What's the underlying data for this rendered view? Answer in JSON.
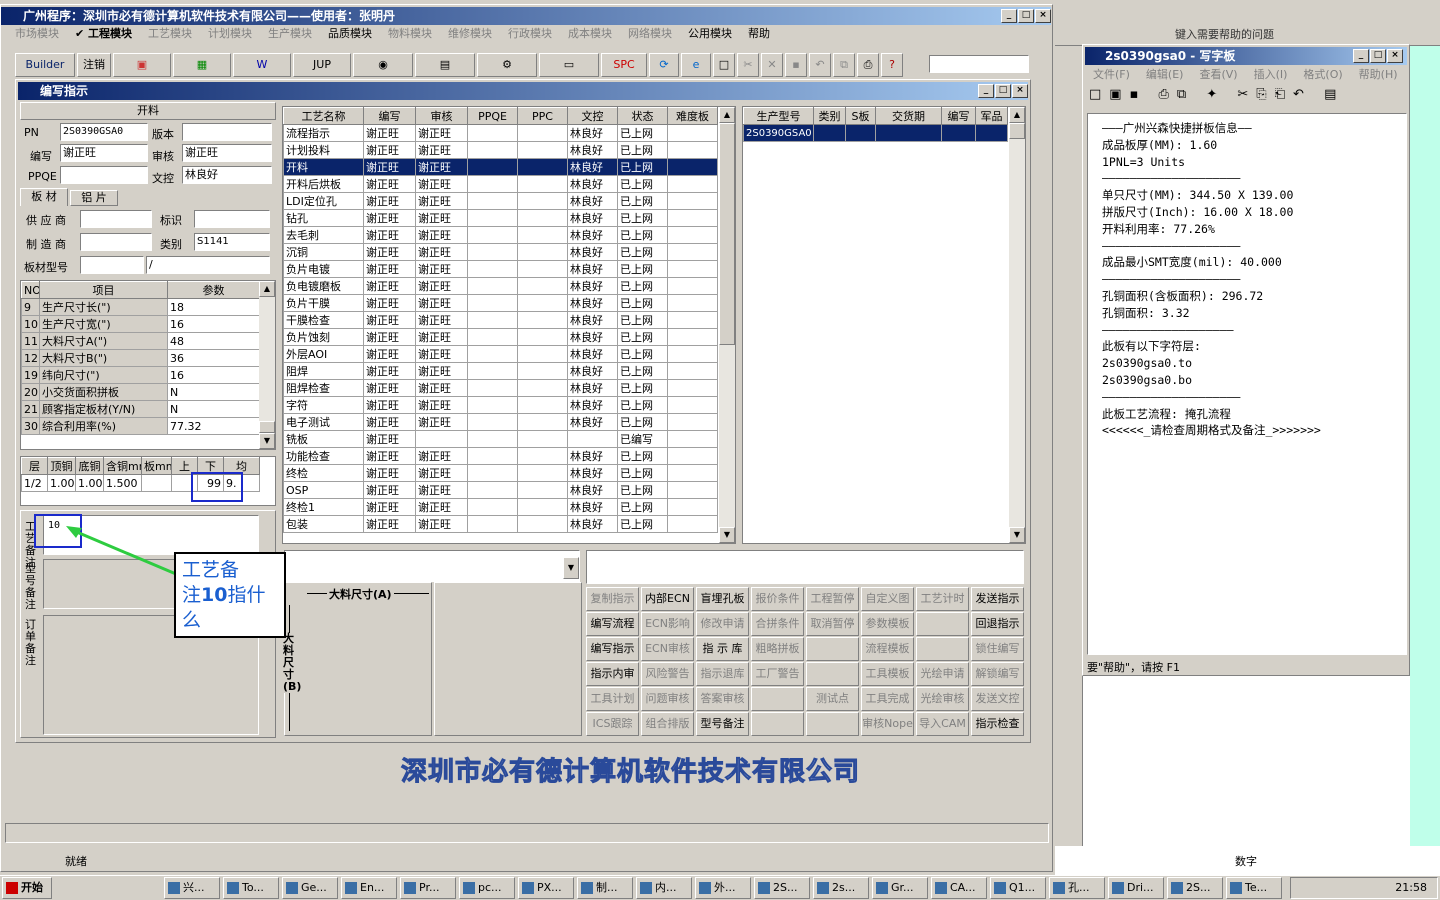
{
  "app": {
    "title": "广州程序：深圳市必有德计算机软件技术有限公司——使用者：张明丹",
    "status": "就绪",
    "footer_logo": "深圳市必有德计算机软件技术有限公司"
  },
  "menu": [
    {
      "label": "市场模块",
      "enabled": false
    },
    {
      "label": "工程模块",
      "enabled": true,
      "checked": true
    },
    {
      "label": "工艺模块",
      "enabled": false
    },
    {
      "label": "计划模块",
      "enabled": false
    },
    {
      "label": "生产模块",
      "enabled": false
    },
    {
      "label": "品质模块",
      "enabled": true
    },
    {
      "label": "物料模块",
      "enabled": false
    },
    {
      "label": "维修模块",
      "enabled": false
    },
    {
      "label": "行政模块",
      "enabled": false
    },
    {
      "label": "成本模块",
      "enabled": false
    },
    {
      "label": "网络模块",
      "enabled": false
    },
    {
      "label": "公用模块",
      "enabled": true
    },
    {
      "label": "帮助",
      "enabled": true
    }
  ],
  "toolbar": {
    "builder": "Builder",
    "logout": "注销",
    "jup": "JUP",
    "spc": "SPC"
  },
  "win": {
    "title": "编写指示"
  },
  "left": {
    "section_title": "开料",
    "pn_label": "PN",
    "pn": "2S0390GSA0",
    "version_label": "版本",
    "version": "",
    "writer_label": "编写",
    "writer": "谢正旺",
    "auditor_label": "审核",
    "auditor": "谢正旺",
    "ppqe_label": "PPQE",
    "ppqe": "",
    "doc_label": "文控",
    "doc": "林良好",
    "tab_board": "板 材",
    "tab_foil": "铝 片",
    "supplier_label": "供 应 商",
    "supplier": "",
    "mark_label": "标识",
    "mark": "",
    "maker_label": "制 造 商",
    "maker": "",
    "category_label": "类别",
    "category": "S1141",
    "model_label": "板材型号",
    "model": "",
    "model2": "/",
    "param_head": [
      "NO",
      "项目",
      "参数"
    ],
    "params": [
      [
        "9",
        "生产尺寸长(\")",
        "18"
      ],
      [
        "10",
        "生产尺寸宽(\")",
        "16"
      ],
      [
        "11",
        "大料尺寸A(\")",
        "48"
      ],
      [
        "12",
        "大料尺寸B(\")",
        "36"
      ],
      [
        "19",
        "纬向尺寸(\")",
        "16"
      ],
      [
        "20",
        "小交货面积拼板",
        "N"
      ],
      [
        "21",
        "顾客指定板材(Y/N)",
        "N"
      ],
      [
        "30",
        "综合利用率(%)",
        "77.32"
      ]
    ],
    "layer_head": [
      "层",
      "顶铜",
      "底铜",
      "含铜mm",
      "板mm",
      "上",
      "下",
      "均"
    ],
    "layer_row": [
      "1/2",
      "1.00",
      "1.00",
      "1.500",
      "",
      "",
      "99",
      "9."
    ],
    "note_value": "10",
    "note_labels": {
      "craft": "工艺备注",
      "model": "型号备注",
      "order": "订单备注"
    }
  },
  "process": {
    "head": [
      "工艺名称",
      "编写",
      "审核",
      "PPQE",
      "PPC",
      "文控",
      "状态",
      "难度板"
    ],
    "rows": [
      [
        "流程指示",
        "谢正旺",
        "谢正旺",
        "",
        "",
        "林良好",
        "已上网",
        ""
      ],
      [
        "计划投料",
        "谢正旺",
        "谢正旺",
        "",
        "",
        "林良好",
        "已上网",
        ""
      ],
      [
        "开料",
        "谢正旺",
        "谢正旺",
        "",
        "",
        "林良好",
        "已上网",
        ""
      ],
      [
        "开料后烘板",
        "谢正旺",
        "谢正旺",
        "",
        "",
        "林良好",
        "已上网",
        ""
      ],
      [
        "LDI定位孔",
        "谢正旺",
        "谢正旺",
        "",
        "",
        "林良好",
        "已上网",
        ""
      ],
      [
        "钻孔",
        "谢正旺",
        "谢正旺",
        "",
        "",
        "林良好",
        "已上网",
        ""
      ],
      [
        "去毛刺",
        "谢正旺",
        "谢正旺",
        "",
        "",
        "林良好",
        "已上网",
        ""
      ],
      [
        "沉铜",
        "谢正旺",
        "谢正旺",
        "",
        "",
        "林良好",
        "已上网",
        ""
      ],
      [
        "负片电镀",
        "谢正旺",
        "谢正旺",
        "",
        "",
        "林良好",
        "已上网",
        ""
      ],
      [
        "负电镀磨板",
        "谢正旺",
        "谢正旺",
        "",
        "",
        "林良好",
        "已上网",
        ""
      ],
      [
        "负片干膜",
        "谢正旺",
        "谢正旺",
        "",
        "",
        "林良好",
        "已上网",
        ""
      ],
      [
        "干膜检查",
        "谢正旺",
        "谢正旺",
        "",
        "",
        "林良好",
        "已上网",
        ""
      ],
      [
        "负片蚀刻",
        "谢正旺",
        "谢正旺",
        "",
        "",
        "林良好",
        "已上网",
        ""
      ],
      [
        "外层AOI",
        "谢正旺",
        "谢正旺",
        "",
        "",
        "林良好",
        "已上网",
        ""
      ],
      [
        "阻焊",
        "谢正旺",
        "谢正旺",
        "",
        "",
        "林良好",
        "已上网",
        ""
      ],
      [
        "阻焊检查",
        "谢正旺",
        "谢正旺",
        "",
        "",
        "林良好",
        "已上网",
        ""
      ],
      [
        "字符",
        "谢正旺",
        "谢正旺",
        "",
        "",
        "林良好",
        "已上网",
        ""
      ],
      [
        "电子测试",
        "谢正旺",
        "谢正旺",
        "",
        "",
        "林良好",
        "已上网",
        ""
      ],
      [
        "铣板",
        "谢正旺",
        "",
        "",
        "",
        "",
        "已编写",
        ""
      ],
      [
        "功能检查",
        "谢正旺",
        "谢正旺",
        "",
        "",
        "林良好",
        "已上网",
        ""
      ],
      [
        "终检",
        "谢正旺",
        "谢正旺",
        "",
        "",
        "林良好",
        "已上网",
        ""
      ],
      [
        "OSP",
        "谢正旺",
        "谢正旺",
        "",
        "",
        "林良好",
        "已上网",
        ""
      ],
      [
        "终检1",
        "谢正旺",
        "谢正旺",
        "",
        "",
        "林良好",
        "已上网",
        ""
      ],
      [
        "包装",
        "谢正旺",
        "谢正旺",
        "",
        "",
        "林良好",
        "已上网",
        ""
      ]
    ],
    "selected": 2
  },
  "prod": {
    "head": [
      "生产型号",
      "类别",
      "S板",
      "交货期",
      "编写",
      "军品"
    ],
    "row": [
      "2S0390GSA0",
      "",
      "",
      "",
      "",
      ""
    ]
  },
  "diagram": {
    "a_label": "大料尺寸(A)",
    "b_label": "大料尺寸(B)"
  },
  "buttons": [
    [
      {
        "t": "复制指示",
        "e": false
      },
      {
        "t": "内部ECN",
        "e": true
      },
      {
        "t": "盲埋孔板",
        "e": true
      },
      {
        "t": "报价条件",
        "e": false
      },
      {
        "t": "工程暂停",
        "e": false
      },
      {
        "t": "自定义图",
        "e": false
      },
      {
        "t": "工艺计时",
        "e": false
      },
      {
        "t": "发送指示",
        "e": true
      }
    ],
    [
      {
        "t": "编写流程",
        "e": true
      },
      {
        "t": "ECN影响",
        "e": false
      },
      {
        "t": "修改申请",
        "e": false
      },
      {
        "t": "合拼条件",
        "e": false
      },
      {
        "t": "取消暂停",
        "e": false
      },
      {
        "t": "参数模板",
        "e": false
      },
      {
        "t": "",
        "e": false
      },
      {
        "t": "回退指示",
        "e": true
      }
    ],
    [
      {
        "t": "编写指示",
        "e": true
      },
      {
        "t": "ECN审核",
        "e": false
      },
      {
        "t": "指 示 库",
        "e": true
      },
      {
        "t": "粗略拼板",
        "e": false
      },
      {
        "t": "",
        "e": false
      },
      {
        "t": "流程模板",
        "e": false
      },
      {
        "t": "",
        "e": false
      },
      {
        "t": "锁住编写",
        "e": false
      }
    ],
    [
      {
        "t": "指示内审",
        "e": true
      },
      {
        "t": "风险警告",
        "e": false
      },
      {
        "t": "指示退库",
        "e": false
      },
      {
        "t": "工厂警告",
        "e": false
      },
      {
        "t": "",
        "e": false
      },
      {
        "t": "工具模板",
        "e": false
      },
      {
        "t": "光绘申请",
        "e": false
      },
      {
        "t": "解锁编写",
        "e": false
      }
    ],
    [
      {
        "t": "工具计划",
        "e": false
      },
      {
        "t": "问题审核",
        "e": false
      },
      {
        "t": "答案审核",
        "e": false
      },
      {
        "t": "",
        "e": false
      },
      {
        "t": "测试点",
        "e": false
      },
      {
        "t": "工具完成",
        "e": false
      },
      {
        "t": "光绘审核",
        "e": false
      },
      {
        "t": "发送文控",
        "e": false
      }
    ],
    [
      {
        "t": "ICS跟踪",
        "e": false
      },
      {
        "t": "组合排版",
        "e": false
      },
      {
        "t": "型号备注",
        "e": true
      },
      {
        "t": "",
        "e": false
      },
      {
        "t": "",
        "e": false
      },
      {
        "t": "审核Nope",
        "e": false
      },
      {
        "t": "导入CAM",
        "e": false
      },
      {
        "t": "指示检查",
        "e": true
      }
    ]
  ],
  "callout": {
    "text1": "工艺备",
    "text2a": "注",
    "text2b": "10",
    "text2c": "指什",
    "text3": "么"
  },
  "notepad": {
    "title": "2s0390gsa0 - 写字板",
    "menu": [
      "文件(F)",
      "编辑(E)",
      "查看(V)",
      "插入(I)",
      "格式(O)",
      "帮助(H)"
    ],
    "lines": [
      "———广州兴森快捷拼板信息——",
      "成品板厚(MM): 1.60",
      "1PNL=3 Units",
      "————————————————————",
      "单只尺寸(MM): 344.50 X 139.00",
      "拼版尺寸(Inch): 16.00 X 18.00",
      "开料利用率: 77.26%",
      "————————————————————",
      "成品最小SMT宽度(mil): 40.000",
      "————————————————————",
      "孔铜面积(含板面积): 296.72",
      "孔铜面积: 3.32",
      "———————————————————",
      "此板有以下字符层:",
      "2s0390gsa0.to",
      "2s0390gsa0.bo",
      "————————————————————",
      "此板工艺流程: 掩孔流程",
      "<<<<<<_请检查周期格式及备注_>>>>>>>"
    ],
    "status": "要\"帮助\"，请按 F1"
  },
  "excel": {
    "help_placeholder": "键入需要帮助的问题",
    "status": "数字"
  },
  "taskbar": {
    "start": "开始",
    "clock": "21:58",
    "items": [
      "兴...",
      "To...",
      "Ge...",
      "En...",
      "Pr...",
      "pc...",
      "PX...",
      "制...",
      "内...",
      "外...",
      "2S...",
      "2s...",
      "Gr...",
      "CA...",
      "Q1...",
      "孔...",
      "Dri...",
      "2S...",
      "Te..."
    ]
  }
}
